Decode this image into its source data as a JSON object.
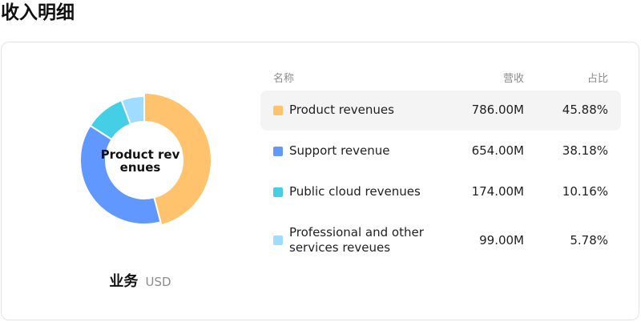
{
  "page_title": "收入明细",
  "chart": {
    "center_label": "Product revenues",
    "subtitle": "业务",
    "unit": "USD"
  },
  "table": {
    "headers": {
      "name": "名称",
      "revenue": "营收",
      "share": "占比"
    },
    "rows": [
      {
        "name": "Product revenues",
        "revenue": "786.00M",
        "share": "45.88%",
        "color": "#ffc36e",
        "selected": true
      },
      {
        "name": "Support revenue",
        "revenue": "654.00M",
        "share": "38.18%",
        "color": "#6098ff",
        "selected": false
      },
      {
        "name": "Public cloud revenues",
        "revenue": "174.00M",
        "share": "10.16%",
        "color": "#45cfe6",
        "selected": false
      },
      {
        "name": "Professional and other services reveues",
        "revenue": "99.00M",
        "share": "5.78%",
        "color": "#9fdcff",
        "selected": false
      }
    ]
  },
  "chart_data": {
    "type": "pie",
    "categories": [
      "Product revenues",
      "Support revenue",
      "Public cloud revenues",
      "Professional and other services reveues"
    ],
    "values": [
      786.0,
      654.0,
      174.0,
      99.0
    ],
    "percentages": [
      45.88,
      38.18,
      10.16,
      5.78
    ],
    "colors": [
      "#ffc36e",
      "#6098ff",
      "#45cfe6",
      "#9fdcff"
    ],
    "highlighted": "Product revenues",
    "unit": "USD",
    "title": "业务"
  }
}
